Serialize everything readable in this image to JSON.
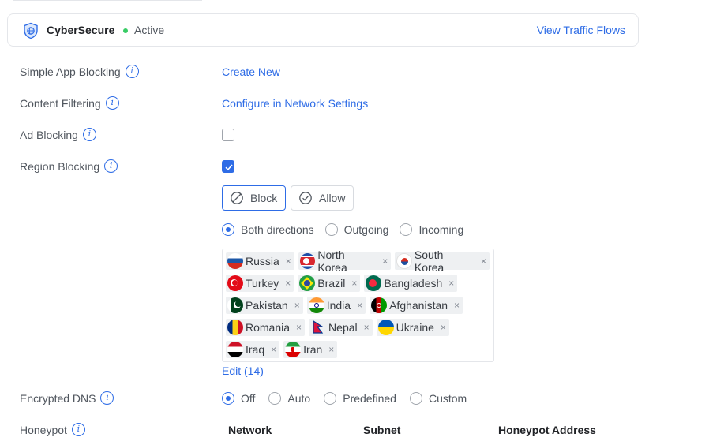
{
  "header": {
    "app_name": "CyberSecure",
    "status": "Active",
    "traffic_link": "View Traffic Flows",
    "status_color": "#38cc65",
    "accent_color": "#2e6ce6"
  },
  "rows": {
    "simple_app_blocking": {
      "label": "Simple App Blocking",
      "action": "Create New"
    },
    "content_filtering": {
      "label": "Content Filtering",
      "action": "Configure in Network Settings"
    },
    "ad_blocking": {
      "label": "Ad Blocking",
      "checked": false
    },
    "region_blocking": {
      "label": "Region Blocking",
      "checked": true
    },
    "encrypted_dns": {
      "label": "Encrypted DNS"
    },
    "honeypot": {
      "label": "Honeypot"
    }
  },
  "region": {
    "mode_buttons": [
      {
        "label": "Block",
        "icon": "block-icon",
        "active": true
      },
      {
        "label": "Allow",
        "icon": "check-circle-icon",
        "active": false
      }
    ],
    "directions": [
      {
        "label": "Both directions",
        "selected": true
      },
      {
        "label": "Outgoing",
        "selected": false
      },
      {
        "label": "Incoming",
        "selected": false
      }
    ],
    "countries": [
      [
        "Russia",
        "North Korea",
        "South Korea"
      ],
      [
        "Turkey",
        "Brazil",
        "Bangladesh"
      ],
      [
        "Pakistan",
        "India",
        "Afghanistan"
      ],
      [
        "Romania",
        "Nepal",
        "Ukraine"
      ],
      [
        "Iraq",
        "Iran"
      ]
    ],
    "remove_glyph": "×",
    "edit_link": "Edit (14)"
  },
  "dns": {
    "options": [
      {
        "label": "Off",
        "selected": true
      },
      {
        "label": "Auto",
        "selected": false
      },
      {
        "label": "Predefined",
        "selected": false
      },
      {
        "label": "Custom",
        "selected": false
      }
    ]
  },
  "honeypot_table": {
    "columns": [
      "Network",
      "Subnet",
      "Honeypot Address"
    ]
  },
  "info_glyph": "i"
}
